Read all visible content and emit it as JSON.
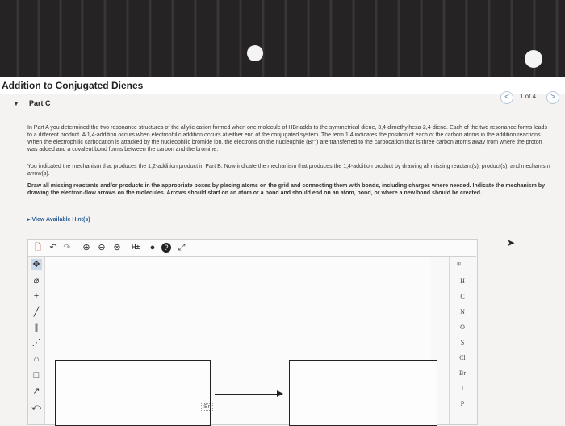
{
  "header": {
    "title": "Addition to Conjugated Dienes"
  },
  "pager": {
    "prev": "<",
    "next": ">",
    "count": "1 of 4"
  },
  "part": {
    "toggle": "▼",
    "label": "Part C"
  },
  "content": {
    "p1": "In Part A you determined the two resonance structures of the allylic cation formed when one molecule of HBr adds to the symmetrical diene, 3,4-dimethylhexa-2,4-diene. Each of the two resonance forms leads to a different product. A 1,4-addition occurs when electrophilic addition occurs at either end of the conjugated system. The term 1,4 indicates the position of each of the carbon atoms in the addition reactions. When the electrophilic carbocation is attacked by the nucleophilic bromide ion, the electrons on the nucleophile (Br⁻) are transferred to the carbocation that is three carbon atoms away from where the proton was added and a covalent bond forms between the carbon and the bromine.",
    "p2": "You indicated the mechanism that produces the 1,2-addition product in Part B. Now indicate the mechanism that produces the 1,4-addition product by drawing all missing reactant(s), product(s), and mechanism arrow(s).",
    "p3": "Draw all missing reactants and/or products in the appropriate boxes by placing atoms on the grid and connecting them with bonds, including charges where needed. Indicate the mechanism by drawing the electron-flow arrows on the molecules. Arrows should start on an atom or a bond and should end on an atom, bond, or where a new bond should be created.",
    "hint": "▸ View Available Hint(s)"
  },
  "toolbar": {
    "new_doc": "🗋",
    "undo": "↶",
    "redo": "↷",
    "zoom_in": "⊕",
    "zoom_out": "⊖",
    "zoom_reset": "⊗",
    "h_toggle": "H±",
    "info": "●",
    "help": "?",
    "expand": "⤢"
  },
  "left_tools": {
    "select": "✥",
    "eraser": "⌀",
    "charge": "+",
    "single_bond": "╱",
    "double_bond": "∥",
    "chain": "⋰",
    "template": "⌂",
    "ring": "□",
    "arrow": "↗",
    "curved_arrow": "⤺"
  },
  "canvas": {
    "bromide_ion": ":Br:"
  },
  "periodic": {
    "label": "⊞"
  },
  "elements": [
    "H",
    "C",
    "N",
    "O",
    "S",
    "Cl",
    "Br",
    "I",
    "P"
  ],
  "colors": {
    "accent": "#2a5d96",
    "header_bg": "#ffffff",
    "top_bg": "#262324"
  }
}
